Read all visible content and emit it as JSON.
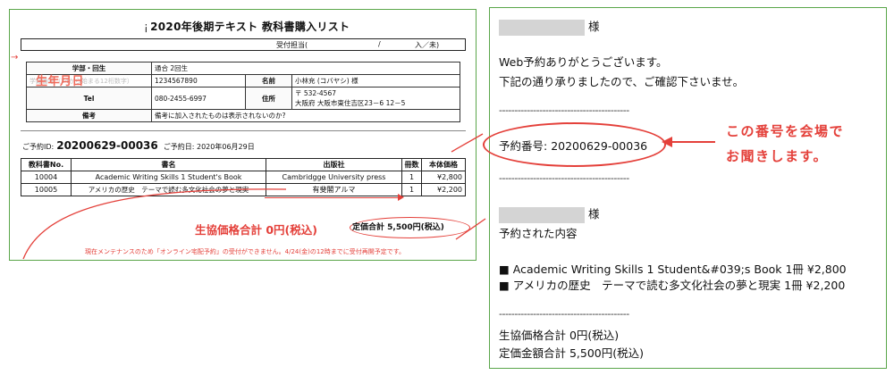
{
  "sheet": {
    "title_mark": "¡",
    "title": "2020年後期テキスト 教科書購入リスト",
    "reception": {
      "label": "受付担当(",
      "slash": "/",
      "end": "入／未)"
    },
    "arrow_mark": "→",
    "info": {
      "row1": {
        "label": "学部・回生",
        "value": "通合 2回生"
      },
      "row2": {
        "hint": "学籍番号（34から始まる12桁数字）",
        "hint_overlay": "生年月日",
        "value": "1234567890",
        "name_label": "名前",
        "name_value": "小林充 (コバヤシ) 様"
      },
      "row3": {
        "label": "Tel",
        "value": "080-2455-6997",
        "addr_label": "住所",
        "addr_zip": "〒 532-4567",
        "addr_value": "大阪府 大阪市東住吉区23－6 12－5"
      },
      "row4": {
        "label": "備考",
        "value": "備考に加入されたものは表示されないのか?"
      }
    },
    "reserve": {
      "label": "ご予約ID:",
      "id": "20200629-00036",
      "date_label": "ご予約日:",
      "date": "2020年06月29日"
    },
    "books_headers": [
      "教科書No.",
      "書名",
      "出版社",
      "冊数",
      "本体価格"
    ],
    "books": [
      {
        "no": "10004",
        "title": "Academic Writing Skills 1 Student's Book",
        "publisher": "Cambridgge University press",
        "qty": "1",
        "price": "¥2,800"
      },
      {
        "no": "10005",
        "title": "アメリカの歴史　テーマで読む多文化社会の夢と現実",
        "publisher": "有斐閣アルマ",
        "qty": "1",
        "price": "¥2,200"
      }
    ],
    "coop_total": "生協価格合計 0円(税込)",
    "list_total": "定価合計 5,500円(税込)",
    "maintenance": "現在メンテナンスのため「オンライン宅配予約」の受付ができません。4/24(金)の12時までに受付再開予定です。"
  },
  "email": {
    "honorific": "様",
    "greeting": "Web予約ありがとうございます。",
    "confirm_text": "下記の通り承りましたので、ご確認下さいませ。",
    "separator": "------------------------------------------",
    "reservation_number_label": "予約番号:",
    "reservation_number": "20200629-00036",
    "reserved_content_label": "予約された内容",
    "items": [
      "■ Academic Writing Skills 1 Student&#039;s Book 1冊 ¥2,800",
      "■ アメリカの歴史　テーマで読む多文化社会の夢と現実 1冊 ¥2,200"
    ],
    "coop_total": "生協価格合計 0円(税込)",
    "list_total": "定価金額合計 5,500円(税込)"
  },
  "callout": {
    "line1": "この番号を会場で",
    "line2": "お聞きします。"
  },
  "colors": {
    "accent_red": "#e4403a",
    "frame_green": "#5aa64a",
    "redact_gray": "#d4d4d4"
  }
}
